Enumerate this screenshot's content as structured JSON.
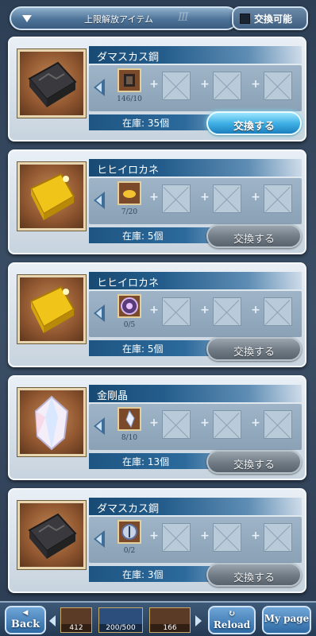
{
  "header": {
    "filter_label": "上限解放アイテム",
    "filter_deco": "Ⅲ",
    "toggle_label": "交換可能",
    "toggle_checked": true
  },
  "items": [
    {
      "name": "ダマスカス鋼",
      "material": "damascus-steel",
      "requirement": {
        "material": "damascus-steel-ore",
        "count": "146/10"
      },
      "stock": "在庫: 35個",
      "exchange_label": "交換する",
      "exchange_enabled": true
    },
    {
      "name": "ヒヒイロカネ",
      "material": "hihiirokane",
      "requirement": {
        "material": "gold-nugget",
        "count": "7/20"
      },
      "stock": "在庫: 5個",
      "exchange_label": "交換する",
      "exchange_enabled": false
    },
    {
      "name": "ヒヒイロカネ",
      "material": "hihiirokane",
      "requirement": {
        "material": "crest-emblem",
        "count": "0/5"
      },
      "stock": "在庫: 5個",
      "exchange_label": "交換する",
      "exchange_enabled": false
    },
    {
      "name": "金剛晶",
      "material": "crystal",
      "requirement": {
        "material": "crystal-shard",
        "count": "8/10"
      },
      "stock": "在庫: 13個",
      "exchange_label": "交換する",
      "exchange_enabled": false
    },
    {
      "name": "ダマスカス鋼",
      "material": "damascus-steel",
      "requirement": {
        "material": "compass-item",
        "count": "0/2"
      },
      "stock": "在庫: 3個",
      "exchange_label": "交換する",
      "exchange_enabled": false
    }
  ],
  "footer": {
    "back_label": "Back",
    "reload_label": "Reload",
    "mypage_label": "My page",
    "counters": [
      "412",
      "200/500",
      "166"
    ]
  },
  "colors": {
    "accent_active": "#3fb0e4",
    "name_bar": "#245d8c",
    "panel_bg": "#dfe7ee"
  }
}
